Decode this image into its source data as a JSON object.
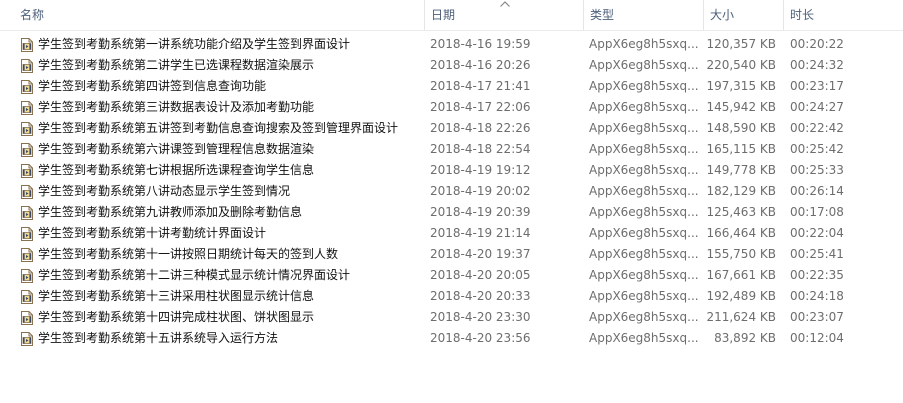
{
  "columns": {
    "name": "名称",
    "date": "日期",
    "type": "类型",
    "size": "大小",
    "duration": "时长"
  },
  "files": [
    {
      "name": "学生签到考勤系统第一讲系统功能介绍及学生签到界面设计",
      "date": "2018-4-16 19:59",
      "type": "AppX6eg8h5sxq...",
      "size": "120,357 KB",
      "duration": "00:20:22"
    },
    {
      "name": "学生签到考勤系统第二讲学生已选课程数据渲染展示",
      "date": "2018-4-16 20:26",
      "type": "AppX6eg8h5sxq...",
      "size": "220,540 KB",
      "duration": "00:24:32"
    },
    {
      "name": "学生签到考勤系统第四讲签到信息查询功能",
      "date": "2018-4-17 21:41",
      "type": "AppX6eg8h5sxq...",
      "size": "197,315 KB",
      "duration": "00:23:17"
    },
    {
      "name": "学生签到考勤系统第三讲数据表设计及添加考勤功能",
      "date": "2018-4-17 22:06",
      "type": "AppX6eg8h5sxq...",
      "size": "145,942 KB",
      "duration": "00:24:27"
    },
    {
      "name": "学生签到考勤系统第五讲签到考勤信息查询搜索及签到管理界面设计",
      "date": "2018-4-18 22:26",
      "type": "AppX6eg8h5sxq...",
      "size": "148,590 KB",
      "duration": "00:22:42"
    },
    {
      "name": "学生签到考勤系统第六讲课签到管理程信息数据渲染",
      "date": "2018-4-18 22:54",
      "type": "AppX6eg8h5sxq...",
      "size": "165,115 KB",
      "duration": "00:25:42"
    },
    {
      "name": "学生签到考勤系统第七讲根据所选课程查询学生信息",
      "date": "2018-4-19 19:12",
      "type": "AppX6eg8h5sxq...",
      "size": "149,778 KB",
      "duration": "00:25:33"
    },
    {
      "name": "学生签到考勤系统第八讲动态显示学生签到情况",
      "date": "2018-4-19 20:02",
      "type": "AppX6eg8h5sxq...",
      "size": "182,129 KB",
      "duration": "00:26:14"
    },
    {
      "name": "学生签到考勤系统第九讲教师添加及删除考勤信息",
      "date": "2018-4-19 20:39",
      "type": "AppX6eg8h5sxq...",
      "size": "125,463 KB",
      "duration": "00:17:08"
    },
    {
      "name": "学生签到考勤系统第十讲考勤统计界面设计",
      "date": "2018-4-19 21:14",
      "type": "AppX6eg8h5sxq...",
      "size": "166,464 KB",
      "duration": "00:22:04"
    },
    {
      "name": "学生签到考勤系统第十一讲按照日期统计每天的签到人数",
      "date": "2018-4-20 19:37",
      "type": "AppX6eg8h5sxq...",
      "size": "155,750 KB",
      "duration": "00:25:41"
    },
    {
      "name": "学生签到考勤系统第十二讲三种模式显示统计情况界面设计",
      "date": "2018-4-20 20:05",
      "type": "AppX6eg8h5sxq...",
      "size": "167,661 KB",
      "duration": "00:22:35"
    },
    {
      "name": "学生签到考勤系统第十三讲采用柱状图显示统计信息",
      "date": "2018-4-20 20:33",
      "type": "AppX6eg8h5sxq...",
      "size": "192,489 KB",
      "duration": "00:24:18"
    },
    {
      "name": "学生签到考勤系统第十四讲完成柱状图、饼状图显示",
      "date": "2018-4-20 23:30",
      "type": "AppX6eg8h5sxq...",
      "size": "211,624 KB",
      "duration": "00:23:07"
    },
    {
      "name": "学生签到考勤系统第十五讲系统导入运行方法",
      "date": "2018-4-20 23:56",
      "type": "AppX6eg8h5sxq...",
      "size": "83,892 KB",
      "duration": "00:12:04"
    }
  ],
  "icons": {
    "file": "video-file-icon",
    "sort": "sort-ascending-icon"
  },
  "colors": {
    "header_text": "#4c607a",
    "icon_frame": "#8a7250",
    "icon_fill": "#f3d98a",
    "icon_film": "#3a4a68"
  }
}
